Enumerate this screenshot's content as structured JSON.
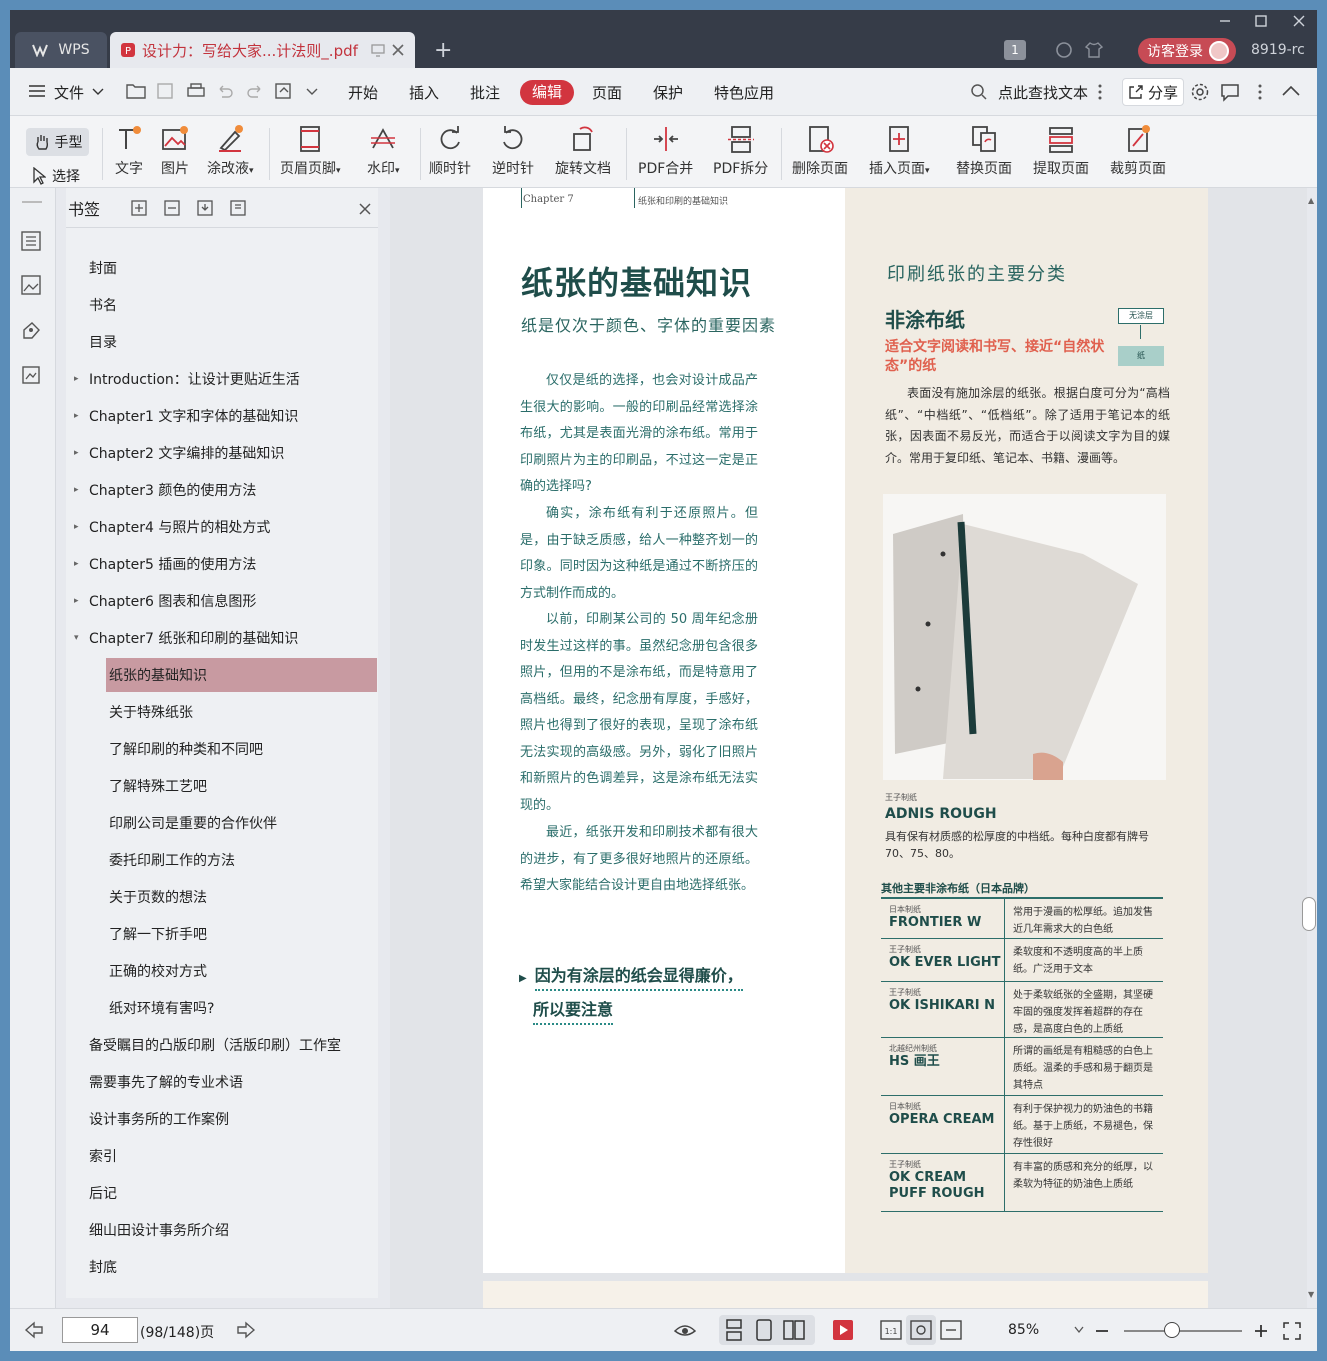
{
  "titlebar": {
    "app_tab": "WPS",
    "doc_tab": "设计力：写给大家...计法则_.pdf",
    "page_badge": "1",
    "login_label": "访客登录",
    "user_id": "8919-rc"
  },
  "menubar": {
    "file": "文件",
    "items": [
      "开始",
      "插入",
      "批注",
      "编辑",
      "页面",
      "保护",
      "特色应用"
    ],
    "search": "点此查找文本",
    "share": "分享"
  },
  "ribbon": {
    "hand": "手型",
    "select": "选择",
    "tools": [
      "文字",
      "图片",
      "涂改液",
      "页眉页脚",
      "水印",
      "顺时针",
      "逆时针",
      "旋转文档",
      "PDF合并",
      "PDF拆分",
      "删除页面",
      "插入页面",
      "替换页面",
      "提取页面",
      "裁剪页面"
    ]
  },
  "bookmarks": {
    "title": "书签",
    "items": [
      {
        "label": "封面",
        "level": 0,
        "arrow": ""
      },
      {
        "label": "书名",
        "level": 0,
        "arrow": ""
      },
      {
        "label": "目录",
        "level": 0,
        "arrow": ""
      },
      {
        "label": "Introduction：让设计更贴近生活",
        "level": 0,
        "arrow": "▸"
      },
      {
        "label": "Chapter1 文字和字体的基础知识",
        "level": 0,
        "arrow": "▸"
      },
      {
        "label": "Chapter2 文字编排的基础知识",
        "level": 0,
        "arrow": "▸"
      },
      {
        "label": "Chapter3 颜色的使用方法",
        "level": 0,
        "arrow": "▸"
      },
      {
        "label": "Chapter4 与照片的相处方式",
        "level": 0,
        "arrow": "▸"
      },
      {
        "label": "Chapter5 插画的使用方法",
        "level": 0,
        "arrow": "▸"
      },
      {
        "label": "Chapter6 图表和信息图形",
        "level": 0,
        "arrow": "▸"
      },
      {
        "label": "Chapter7 纸张和印刷的基础知识",
        "level": 0,
        "arrow": "▾"
      },
      {
        "label": "纸张的基础知识",
        "level": 1,
        "arrow": "",
        "selected": true
      },
      {
        "label": "关于特殊纸张",
        "level": 1,
        "arrow": ""
      },
      {
        "label": "了解印刷的种类和不同吧",
        "level": 1,
        "arrow": ""
      },
      {
        "label": "了解特殊工艺吧",
        "level": 1,
        "arrow": ""
      },
      {
        "label": "印刷公司是重要的合作伙伴",
        "level": 1,
        "arrow": ""
      },
      {
        "label": "委托印刷工作的方法",
        "level": 1,
        "arrow": ""
      },
      {
        "label": "关于页数的想法",
        "level": 1,
        "arrow": ""
      },
      {
        "label": "了解一下折手吧",
        "level": 1,
        "arrow": ""
      },
      {
        "label": "正确的校对方式",
        "level": 1,
        "arrow": ""
      },
      {
        "label": "纸对环境有害吗?",
        "level": 1,
        "arrow": ""
      },
      {
        "label": "备受瞩目的凸版印刷（活版印刷）工作室",
        "level": 0,
        "arrow": ""
      },
      {
        "label": "需要事先了解的专业术语",
        "level": 0,
        "arrow": ""
      },
      {
        "label": "设计事务所的工作案例",
        "level": 0,
        "arrow": ""
      },
      {
        "label": "索引",
        "level": 0,
        "arrow": ""
      },
      {
        "label": "后记",
        "level": 0,
        "arrow": ""
      },
      {
        "label": "细山田设计事务所介绍",
        "level": 0,
        "arrow": ""
      },
      {
        "label": "封底",
        "level": 0,
        "arrow": ""
      }
    ]
  },
  "page": {
    "chapter": "Chapter 7",
    "chapter_title": "纸张和印刷的基础知识",
    "title": "纸张的基础知识",
    "subtitle": "纸是仅次于颜色、字体的重要因素",
    "paragraphs": [
      "仅仅是纸的选择，也会对设计成品产生很大的影响。一般的印刷品经常选择涂布纸，尤其是表面光滑的涂布纸。常用于印刷照片为主的印刷品，不过这一定是正确的选择吗?",
      "确实，涂布纸有利于还原照片。但是，由于缺乏质感，给人一种整齐划一的印象。同时因为这种纸是通过不断挤压的方式制作而成的。",
      "以前，印刷某公司的 50 周年纪念册时发生过这样的事。虽然纪念册包含很多照片，但用的不是涂布纸，而是特意用了高档纸。最终，纪念册有厚度，手感好，照片也得到了很好的表现，呈现了涂布纸无法实现的高级感。另外，弱化了旧照片和新照片的色调差异，这是涂布纸无法实现的。",
      "最近，纸张开发和印刷技术都有很大的进步，有了更多很好地照片的还原纸。希望大家能结合设计更自由地选择纸张。"
    ],
    "callout_line1": "因为有涂层的纸会显得廉价，",
    "callout_line2": "所以要注意",
    "right_title": "印刷纸张的主要分类",
    "right_h2": "非涂布纸",
    "right_sub": "适合文字阅读和书写、接近“自然状态”的纸",
    "label_top": "无涂层",
    "label_bottom": "纸",
    "right_body": "表面没有施加涂层的纸张。根据白度可分为“高档纸”、“中档纸”、“低档纸”。除了适用于笔记本的纸张，因表面不易反光，而适合于以阅读文字为目的媒介。常用于复印纸、笔记本、书籍、漫画等。",
    "photo_maker": "王子制纸",
    "photo_name": "ADNIS ROUGH",
    "photo_desc": "具有保有材质感的松厚度的中档纸。每种白度都有牌号 70、75、80。",
    "other_heading": "其他主要非涂布纸（日本品牌）",
    "table": [
      {
        "maker": "日本制纸",
        "name": "FRONTIER W",
        "desc": "常用于漫画的松厚纸。追加发售近几年需求大的白色纸"
      },
      {
        "maker": "王子制纸",
        "name": "OK EVER LIGHT",
        "desc": "柔软度和不透明度高的半上质纸。广泛用于文本"
      },
      {
        "maker": "王子制纸",
        "name": "OK ISHIKARI N",
        "desc": "处于柔软纸张的全盛期，其坚硬牢固的强度发挥着超群的存在感，是高度白色的上质纸"
      },
      {
        "maker": "北越纪州制纸",
        "name": "HS 画王",
        "desc": "所谓的画纸是有粗糙感的白色上质纸。温柔的手感和易于翻页是其特点"
      },
      {
        "maker": "日本制纸",
        "name": "OPERA CREAM",
        "desc": "有利于保护视力的奶油色的书籍纸。基于上质纸，不易褪色，保存性很好"
      },
      {
        "maker": "王子制纸",
        "name": "OK CREAM PUFF ROUGH",
        "desc": "有丰富的质感和充分的纸厚，以柔软为特征的奶油色上质纸"
      }
    ]
  },
  "status": {
    "page_input": "94",
    "page_total": "(98/148)页",
    "zoom": "85%"
  },
  "colors": {
    "accent": "#d2353f",
    "teal": "#1f4d4a",
    "selection": "#c89aa1"
  }
}
